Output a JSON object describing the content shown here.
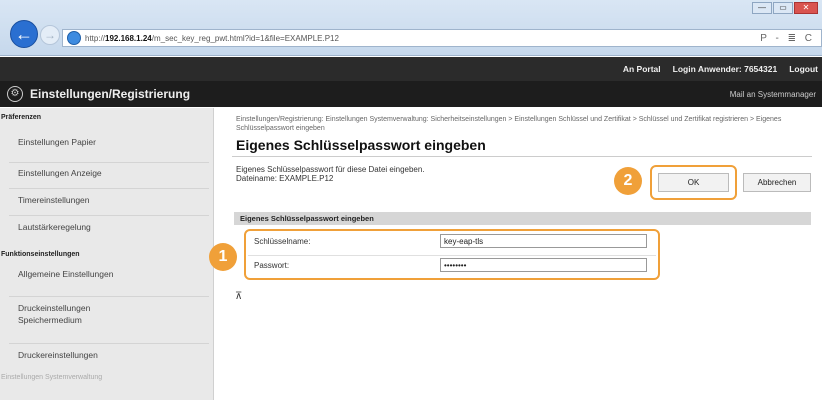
{
  "browser": {
    "url_prefix": "http://",
    "url_host": "192.168.1.24",
    "url_path": "/m_sec_key_reg_pwt.html?id=1&file=EXAMPLE.P12",
    "tools": "P - ≣ C",
    "window_min": "—",
    "window_max": "▭",
    "window_close": "✕",
    "back_glyph": "←",
    "fwd_glyph": "→"
  },
  "header": {
    "links": [
      "An Portal",
      "Login Anwender: 7654321",
      "Logout"
    ],
    "title": "Einstellungen/Registrierung",
    "mail_link": "Mail an Systemmanager"
  },
  "sidebar": {
    "sections": [
      {
        "label": "Präferenzen",
        "items": [
          "Einstellungen Papier",
          "Einstellungen Anzeige",
          "Timereinstellungen",
          "Lautstärkeregelung"
        ]
      },
      {
        "label": "Funktionseinstellungen",
        "items": [
          "Allgemeine Einstellungen",
          "Druckeinstellungen\nSpeichermedium",
          "Druckereinstellungen"
        ]
      },
      {
        "label": "Einstellungen Systemverwaltung",
        "items": []
      }
    ]
  },
  "main": {
    "breadcrumb": "Einstellungen/Registrierung: Einstellungen Systemverwaltung: Sicherheitseinstellungen > Einstellungen Schlüssel und Zertifikat > Schlüssel und Zertifikat registrieren > Eigenes Schlüsselpasswort eingeben",
    "title": "Eigenes Schlüsselpasswort eingeben",
    "description": "Eigenes Schlüsselpasswort für diese Datei eingeben.",
    "file_line": "Dateiname: EXAMPLE.P12",
    "ok_label": "OK",
    "cancel_label": "Abbrechen",
    "section_title": "Eigenes Schlüsselpasswort eingeben",
    "fields": [
      {
        "label": "Schlüsselname:",
        "value": "key-eap-tls"
      },
      {
        "label": "Passwort:",
        "value": "••••••••"
      }
    ],
    "top_anchor": "⊼"
  },
  "callouts": [
    "1",
    "2"
  ],
  "colors": {
    "accent": "#f0a039",
    "header_bg": "#1d1d1d",
    "nav_blue": "#2a6fd1"
  }
}
